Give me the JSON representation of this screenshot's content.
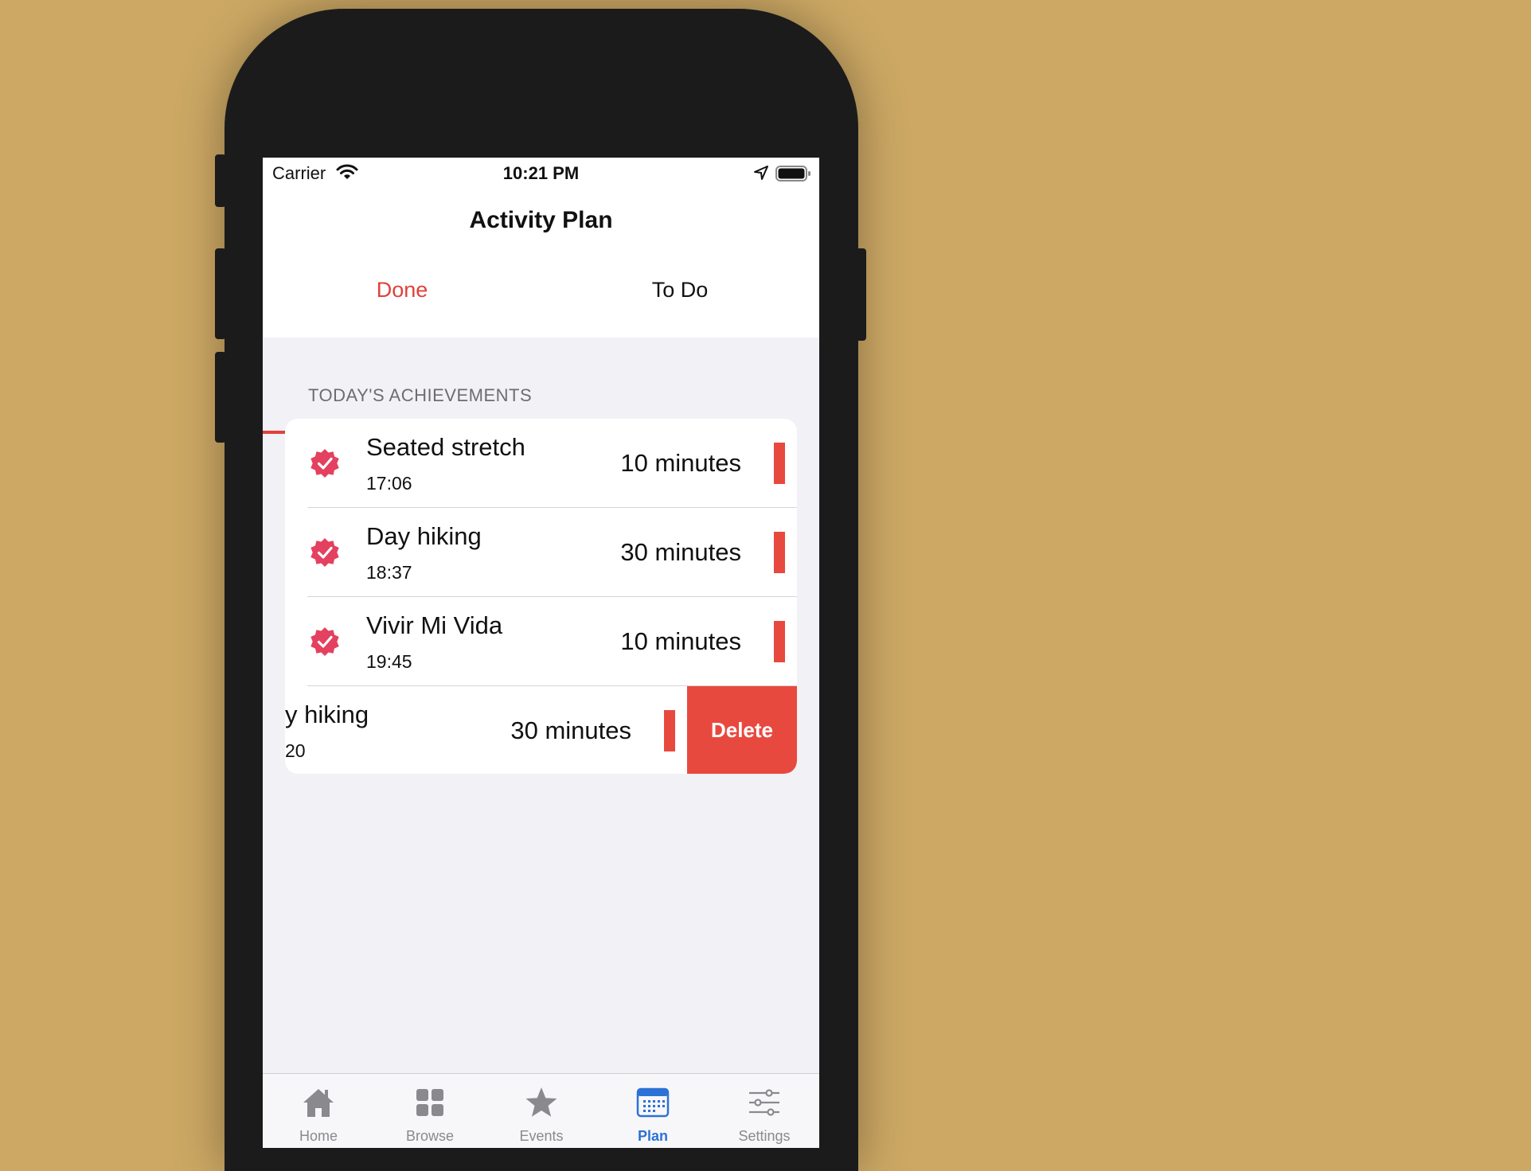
{
  "status_bar": {
    "carrier": "Carrier",
    "time": "10:21 PM"
  },
  "nav": {
    "title": "Activity Plan"
  },
  "segment_tabs": [
    {
      "label": "Done",
      "selected": true
    },
    {
      "label": "To Do",
      "selected": false
    }
  ],
  "section": {
    "header": "TODAY'S ACHIEVEMENTS"
  },
  "achievements": [
    {
      "title": "Seated stretch",
      "time": "17:06",
      "duration": "10  minutes"
    },
    {
      "title": "Day hiking",
      "time": "18:37",
      "duration": "30 minutes"
    },
    {
      "title": "Vivir Mi Vida",
      "time": "19:45",
      "duration": "10  minutes"
    }
  ],
  "swiped_row": {
    "title": "y hiking",
    "time": "20",
    "duration": "30 minutes",
    "delete_label": "Delete"
  },
  "bottom_tabs": [
    {
      "label": "Home",
      "icon": "home-icon",
      "active": false
    },
    {
      "label": "Browse",
      "icon": "grid-icon",
      "active": false
    },
    {
      "label": "Events",
      "icon": "star-icon",
      "active": false
    },
    {
      "label": "Plan",
      "icon": "calendar-icon",
      "active": true
    },
    {
      "label": "Settings",
      "icon": "sliders-icon",
      "active": false
    }
  ],
  "colors": {
    "accent": "#e0413a",
    "check": "#e4405f",
    "active_tab": "#2c72d6",
    "background": "#cca864"
  }
}
